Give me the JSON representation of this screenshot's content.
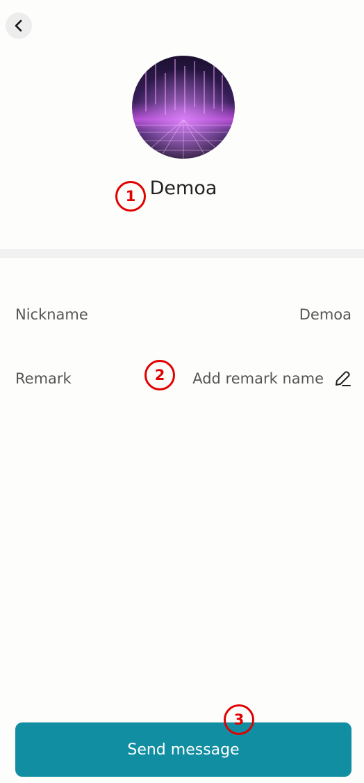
{
  "header": {
    "back_icon": "chevron-left-icon"
  },
  "profile": {
    "name": "Demoa"
  },
  "info": {
    "nickname_label": "Nickname",
    "nickname_value": "Demoa",
    "remark_label": "Remark",
    "remark_value": "Add remark name",
    "remark_icon": "pencil-icon"
  },
  "annotations": [
    "1",
    "2",
    "3"
  ],
  "actions": {
    "send_label": "Send message"
  },
  "colors": {
    "accent": "#118ea2",
    "annotation": "#e00000"
  }
}
